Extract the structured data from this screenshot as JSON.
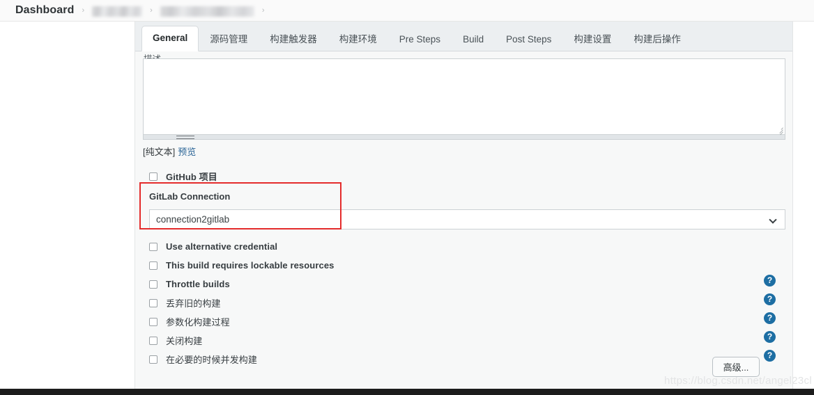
{
  "breadcrumb": {
    "root_label": "Dashboard",
    "separator": "›",
    "redacted_items": [
      "",
      ""
    ]
  },
  "tabs": [
    {
      "label": "General",
      "active": true
    },
    {
      "label": "源码管理",
      "active": false
    },
    {
      "label": "构建触发器",
      "active": false
    },
    {
      "label": "构建环境",
      "active": false
    },
    {
      "label": "Pre Steps",
      "active": false
    },
    {
      "label": "Build",
      "active": false
    },
    {
      "label": "Post Steps",
      "active": false
    },
    {
      "label": "构建设置",
      "active": false
    },
    {
      "label": "构建后操作",
      "active": false
    }
  ],
  "form": {
    "description_label": "描述",
    "description_value": "",
    "plain_text_label": "[纯文本]",
    "preview_link": "预览",
    "github_project_label": "GitHub 项目",
    "gitlab_connection_label": "GitLab Connection",
    "gitlab_connection_value": "connection2gitlab",
    "checkboxes": [
      {
        "label": "Use alternative credential",
        "checked": false,
        "cjk": false
      },
      {
        "label": "This build requires lockable resources",
        "checked": false,
        "cjk": false
      },
      {
        "label": "Throttle builds",
        "checked": false,
        "cjk": false
      },
      {
        "label": "丢弃旧的构建",
        "checked": false,
        "cjk": true
      },
      {
        "label": "参数化构建过程",
        "checked": false,
        "cjk": true
      },
      {
        "label": "关闭构建",
        "checked": false,
        "cjk": true
      },
      {
        "label": "在必要的时候并发构建",
        "checked": false,
        "cjk": true
      }
    ],
    "help_icons": [
      {
        "glyph": "?"
      },
      {
        "glyph": "?"
      },
      {
        "glyph": "?"
      },
      {
        "glyph": "?"
      },
      {
        "glyph": "?"
      }
    ],
    "advanced_button_label": "高级..."
  },
  "annotation": {
    "color": "#e42b2b"
  },
  "watermark": {
    "text": "https://blog.csdn.net/angel23cl"
  },
  "colors": {
    "accent_link": "#2a6496",
    "help_icon": "#1d6ea3",
    "annotation_red": "#e42b2b",
    "tabbar_bg": "#eceff1",
    "panel_bg": "#f7f8f8"
  }
}
